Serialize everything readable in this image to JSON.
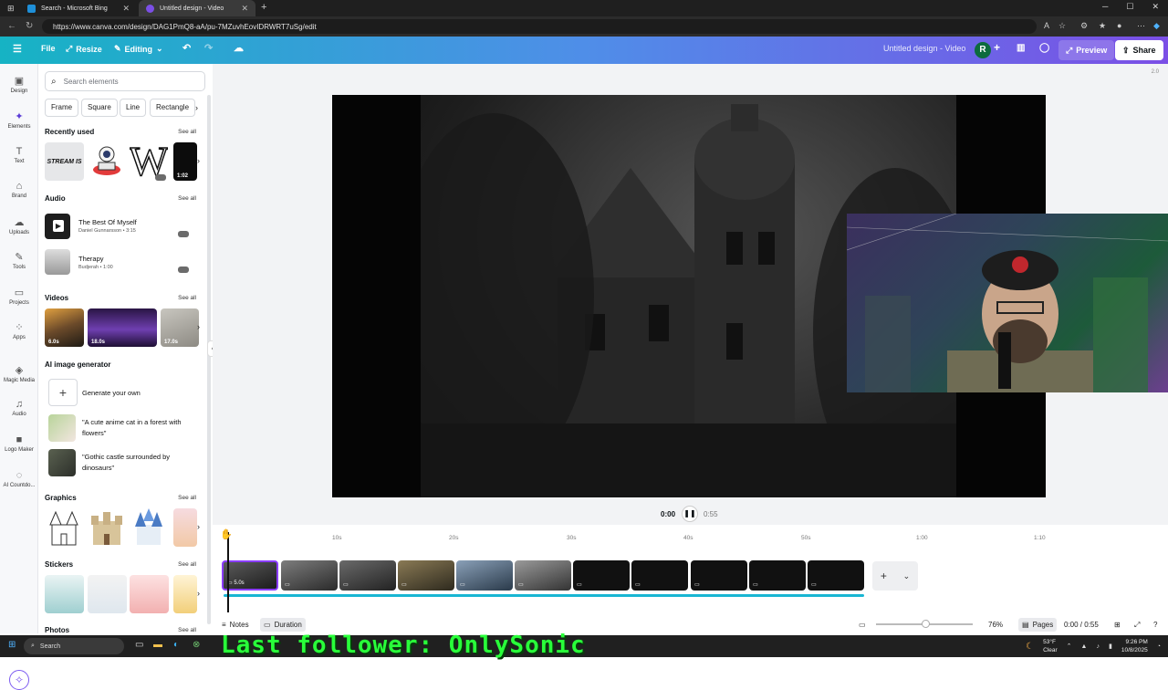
{
  "browser": {
    "tabs": [
      {
        "title": "Search - Microsoft Bing"
      },
      {
        "title": "Untitled design - Video"
      }
    ],
    "url": "https://www.canva.com/design/DAG1PmQ8-aA/pu-7MZuvhEovIDRWRT7uSg/edit"
  },
  "header": {
    "file_label": "File",
    "resize_label": "Resize",
    "editing_label": "Editing",
    "design_title": "Untitled design - Video",
    "avatar_initial": "R",
    "preview_label": "Preview",
    "share_label": "Share"
  },
  "rail": {
    "items": [
      "Design",
      "Elements",
      "Text",
      "Brand",
      "Uploads",
      "Tools",
      "Projects",
      "Apps",
      "Magic Media",
      "Audio",
      "Logo Maker",
      "AI Countdo..."
    ]
  },
  "panel": {
    "search_placeholder": "Search elements",
    "chips": [
      "Frame",
      "Square",
      "Line",
      "Rectangle"
    ],
    "recently_used": {
      "title": "Recently used",
      "see_all": "See all",
      "stream_text": "STREAM IS",
      "letter_w": "W",
      "video_duration": "1:02"
    },
    "audio": {
      "title": "Audio",
      "see_all": "See all",
      "tracks": [
        {
          "title": "The Best Of Myself",
          "artist": "Daniel Gunnarsson • 3:15"
        },
        {
          "title": "Therapy",
          "artist": "Budjerah • 1:00"
        }
      ]
    },
    "videos": {
      "title": "Videos",
      "see_all": "See all",
      "durations": [
        "6.0s",
        "18.0s",
        "17.0s"
      ]
    },
    "ai_generator": {
      "title": "AI image generator",
      "generate_label": "Generate your own",
      "prompts": [
        "\"A cute anime cat in a forest with flowers\"",
        "\"Gothic castle surrounded by dinosaurs\""
      ]
    },
    "graphics": {
      "title": "Graphics",
      "see_all": "See all"
    },
    "stickers": {
      "title": "Stickers",
      "see_all": "See all"
    },
    "photos": {
      "title": "Photos",
      "see_all": "See all"
    }
  },
  "canvas": {
    "page_number": "2.0"
  },
  "playback": {
    "current": "0:00",
    "total": "0:55"
  },
  "timeline": {
    "ticks": [
      "10s",
      "20s",
      "30s",
      "40s",
      "50s",
      "1:00",
      "1:10"
    ],
    "first_clip_duration": "5.0s",
    "clip_count": 11
  },
  "footer": {
    "notes_label": "Notes",
    "duration_label": "Duration",
    "zoom": "76%",
    "pages_label": "Pages",
    "time": "0:00 / 0:55"
  },
  "taskbar": {
    "search_label": "Search",
    "overlay_text": "Last follower: OnlySonic",
    "weather_temp": "53°F",
    "weather_cond": "Clear",
    "clock_time": "9:26 PM",
    "clock_date": "10/8/2025"
  },
  "colors": {
    "accent": "#8b3dff",
    "header_gradient_start": "#16b3c4",
    "header_gradient_end": "#7b4fe6",
    "audio_track": "#18b6d3",
    "overlay_green": "#29ff3a"
  }
}
